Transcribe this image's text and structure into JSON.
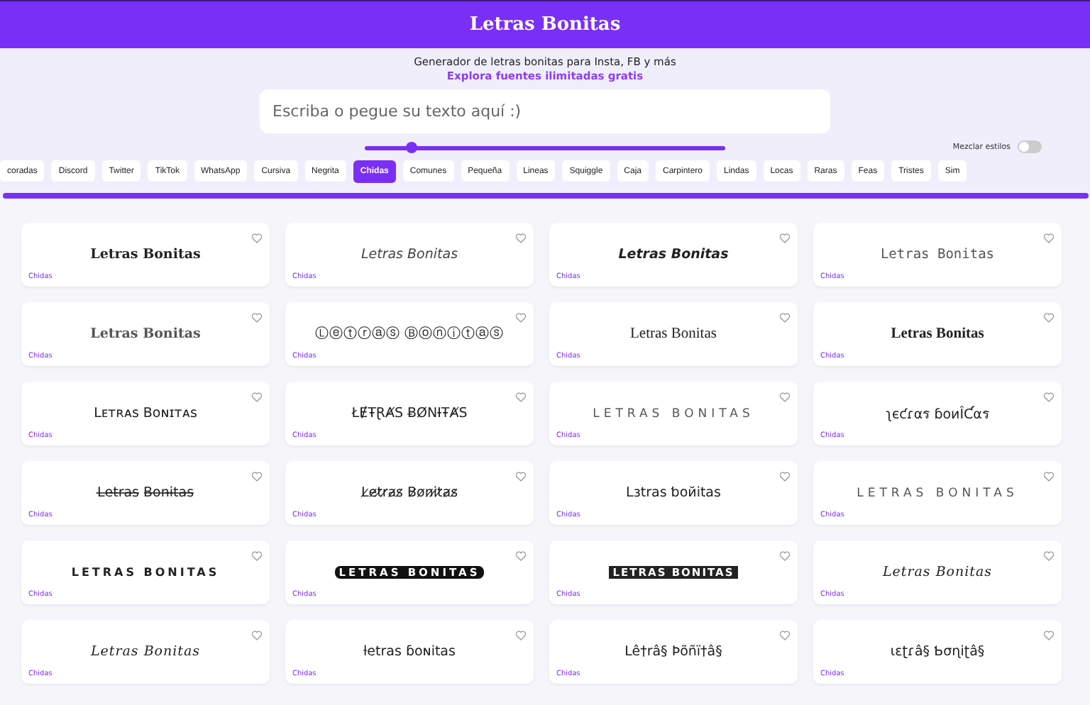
{
  "header": {
    "title": "Letras Bonitas"
  },
  "subtitle": "Generador de letras bonitas para Insta, FB y más",
  "link": "Explora fuentes ilimitadas gratis",
  "search": {
    "placeholder": "Escriba o pegue su texto aquí :)"
  },
  "slider": {
    "level": 0.13
  },
  "mix_toggle": {
    "label": "Mezclar estilos",
    "on": false
  },
  "tabs": [
    {
      "label": "coradas",
      "selected": false
    },
    {
      "label": "Discord",
      "selected": false
    },
    {
      "label": "Twitter",
      "selected": false
    },
    {
      "label": "TikTok",
      "selected": false
    },
    {
      "label": "WhatsApp",
      "selected": false
    },
    {
      "label": "Cursiva",
      "selected": false
    },
    {
      "label": "Negrita",
      "selected": false
    },
    {
      "label": "Chidas",
      "selected": true
    },
    {
      "label": "Comunes",
      "selected": false
    },
    {
      "label": "Pequeña",
      "selected": false
    },
    {
      "label": "Lineas",
      "selected": false
    },
    {
      "label": "Squiggle",
      "selected": false
    },
    {
      "label": "Caja",
      "selected": false
    },
    {
      "label": "Carpintero",
      "selected": false
    },
    {
      "label": "Lindas",
      "selected": false
    },
    {
      "label": "Locas",
      "selected": false
    },
    {
      "label": "Raras",
      "selected": false
    },
    {
      "label": "Feas",
      "selected": false
    },
    {
      "label": "Tristes",
      "selected": false
    },
    {
      "label": "Sim",
      "selected": false
    }
  ],
  "cards": [
    {
      "text": "Letras Bonitas",
      "kind": "serifbold",
      "tag": "Chidas"
    },
    {
      "text": "Letras Bonitas",
      "kind": "italic",
      "tag": "Chidas"
    },
    {
      "text": "Letras Bonitas",
      "kind": "bolditalic",
      "tag": "Chidas"
    },
    {
      "text": "Letras Bonitas",
      "kind": "mono",
      "tag": "Chidas"
    },
    {
      "text": "Letras Bonitas",
      "kind": "serifgrey",
      "tag": "Chidas"
    },
    {
      "text": "Ⓛⓔⓣⓡⓐⓢ Ⓑⓞⓝⓘⓣⓐⓢ",
      "kind": "plain",
      "tag": "Chidas"
    },
    {
      "text": "Letras Bonitas",
      "kind": "gothic",
      "tag": "Chidas"
    },
    {
      "text": "Letras Bonitas",
      "kind": "gothicbold",
      "tag": "Chidas"
    },
    {
      "text": "Lᴇᴛʀᴀs Bᴏɴɪᴛᴀs",
      "kind": "plain",
      "tag": "Chidas"
    },
    {
      "text": "ŁɆŦⱤȺS ɃØNƗŦȺS",
      "kind": "plain",
      "tag": "Chidas"
    },
    {
      "text": "LETRAS BONITAS",
      "kind": "spaced",
      "tag": "Chidas"
    },
    {
      "text": "ʅєƈɾαร ɓoиÎƇαร",
      "kind": "plain",
      "tag": "Chidas"
    },
    {
      "text": "L̶e̶t̶r̶a̶s̶ B̶o̶n̶i̶t̶a̶s̶",
      "kind": "plain",
      "tag": "Chidas"
    },
    {
      "text": "L̷e̷t̷r̷a̷s̷ B̷o̷n̷i̷t̷a̷s̷",
      "kind": "plain",
      "tag": "Chidas"
    },
    {
      "text": "Lɜtras ƅoйitas",
      "kind": "plain",
      "tag": "Chidas"
    },
    {
      "text": "LETRAS BONITAS",
      "kind": "spaced",
      "tag": "Chidas"
    },
    {
      "text": "LETRAS BONITAS",
      "kind": "wide",
      "tag": "Chidas"
    },
    {
      "text": "LETRAS BONITAS",
      "kind": "dark",
      "tag": "Chidas"
    },
    {
      "text": "LETRAS BONITAS",
      "kind": "boxed",
      "tag": "Chidas"
    },
    {
      "text": "Letras Bonitas",
      "kind": "script",
      "tag": "Chidas"
    },
    {
      "text": "Letras Bonitas",
      "kind": "script",
      "tag": "Chidas"
    },
    {
      "text": "ƚetras ɓoɴitas",
      "kind": "plain",
      "tag": "Chidas"
    },
    {
      "text": "Lê†râ§ Þõñï†â§",
      "kind": "plain",
      "tag": "Chidas"
    },
    {
      "text": "ɩɛʈɾâ§ Ƅσɳiʈâ§",
      "kind": "plain",
      "tag": "Chidas"
    }
  ]
}
